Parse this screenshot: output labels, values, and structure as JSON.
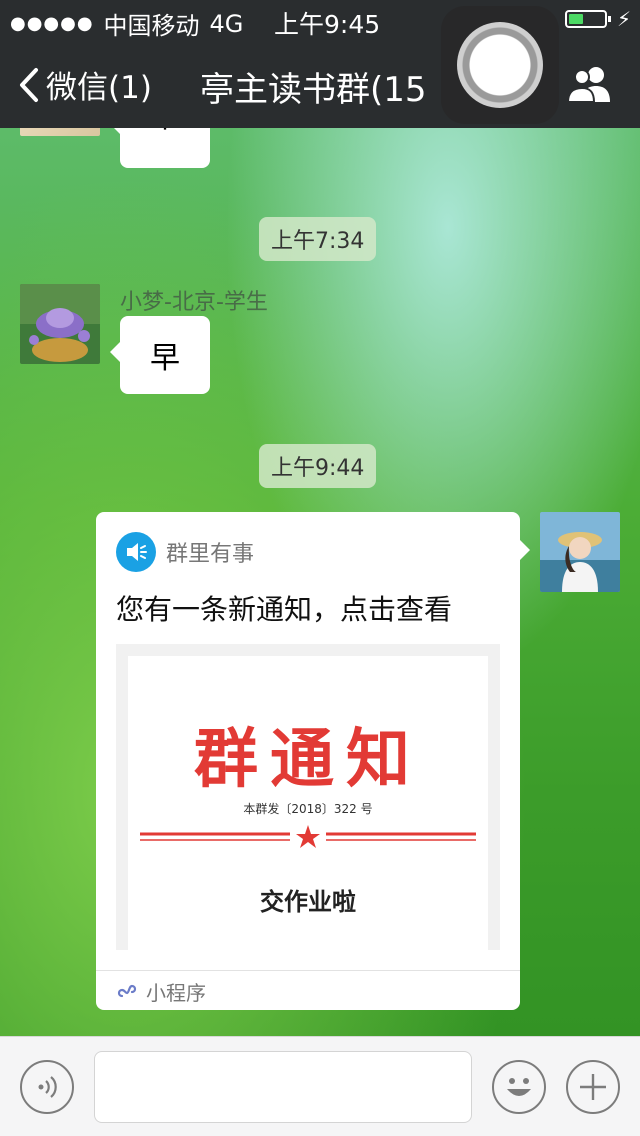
{
  "status_bar": {
    "signal": "●●●●●",
    "carrier": "中国移动",
    "network": "4G",
    "time": "上午9:45",
    "battery_level": 0.4
  },
  "nav": {
    "back_label": "微信(1)",
    "title": "亭主读书群(15",
    "members_icon": "members-icon"
  },
  "messages": {
    "partial_bubble_text": "午",
    "time_1": "上午7:34",
    "sender_name": "小梦-北京-学生",
    "bubble_text": "早",
    "time_2": "上午9:44"
  },
  "card": {
    "source": "群里有事",
    "title": "您有一条新通知，点击查看",
    "notice_title": "群通知",
    "notice_sub": "本群发〔2018〕322 号",
    "notice_subject": "交作业啦",
    "footer_label": "小程序"
  },
  "input_bar": {
    "voice_icon": "voice-icon",
    "emoji_icon": "emoji-icon",
    "plus_icon": "plus-icon",
    "placeholder": ""
  },
  "colors": {
    "nav_bg": "#2a2d2f",
    "notice_red": "#e23a35",
    "speaker_blue": "#1aa1e4",
    "battery_green": "#4cd964"
  }
}
